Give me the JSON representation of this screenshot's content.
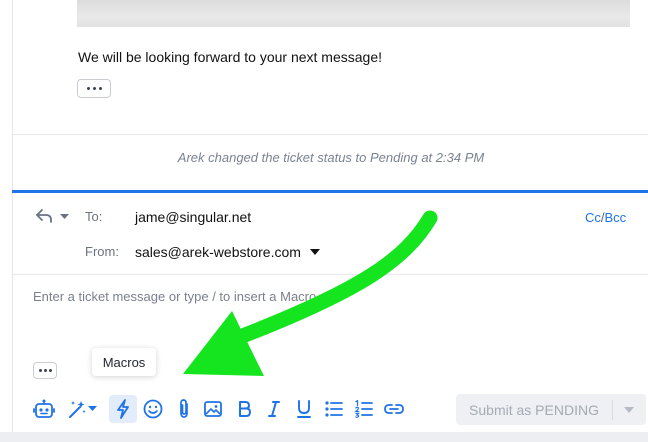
{
  "thread": {
    "quoted_message_text": "We will be looking forward to your next message!",
    "status_event": "Arek changed the ticket status to Pending at 2:34 PM"
  },
  "composer": {
    "to_label": "To:",
    "to_value": "jame@singular.net",
    "from_label": "From:",
    "from_value": "sales@arek-webstore.com",
    "cc_label": "Cc",
    "cc_separator": "/",
    "bcc_label": "Bcc",
    "placeholder": "Enter a ticket message or type / to insert a Macro",
    "tooltip": "Macros",
    "submit_label": "Submit as PENDING"
  },
  "toolbar_icons": [
    "bot-icon",
    "magic-wand-icon",
    "lightning-icon",
    "emoji-icon",
    "paperclip-icon",
    "image-icon",
    "bold-icon",
    "italic-icon",
    "underline-icon",
    "bullet-list-icon",
    "numbered-list-icon",
    "link-icon"
  ],
  "colors": {
    "accent": "#1f73e8",
    "annotation_arrow": "#14e51e",
    "toolbar_icon": "#1f73e8",
    "submit_disabled_bg": "#eef0f3"
  }
}
